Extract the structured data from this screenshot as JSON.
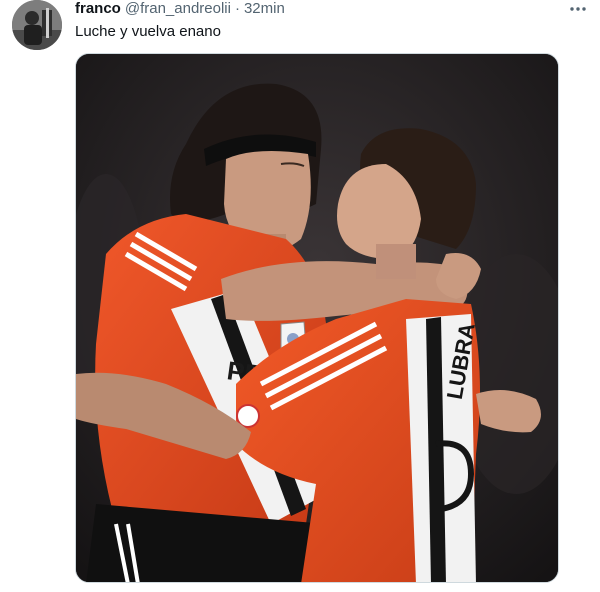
{
  "tweet": {
    "author": {
      "display_name": "franco",
      "handle": "@fran_andreolii",
      "separator": "·",
      "time": "32min",
      "avatar_icon": "user-avatar"
    },
    "text": "Luche y vuelva enano",
    "more_icon": "more-horizontal-icon",
    "media": {
      "kind": "photo",
      "jersey_text_left": "PET",
      "jersey_text_right": "LUBRA"
    }
  },
  "colors": {
    "text_primary": "#0f1419",
    "text_secondary": "#536471",
    "border": "#cfd9de",
    "jersey_red": "#e2461d",
    "jersey_white": "#f2f2f2",
    "jersey_black": "#151515"
  }
}
